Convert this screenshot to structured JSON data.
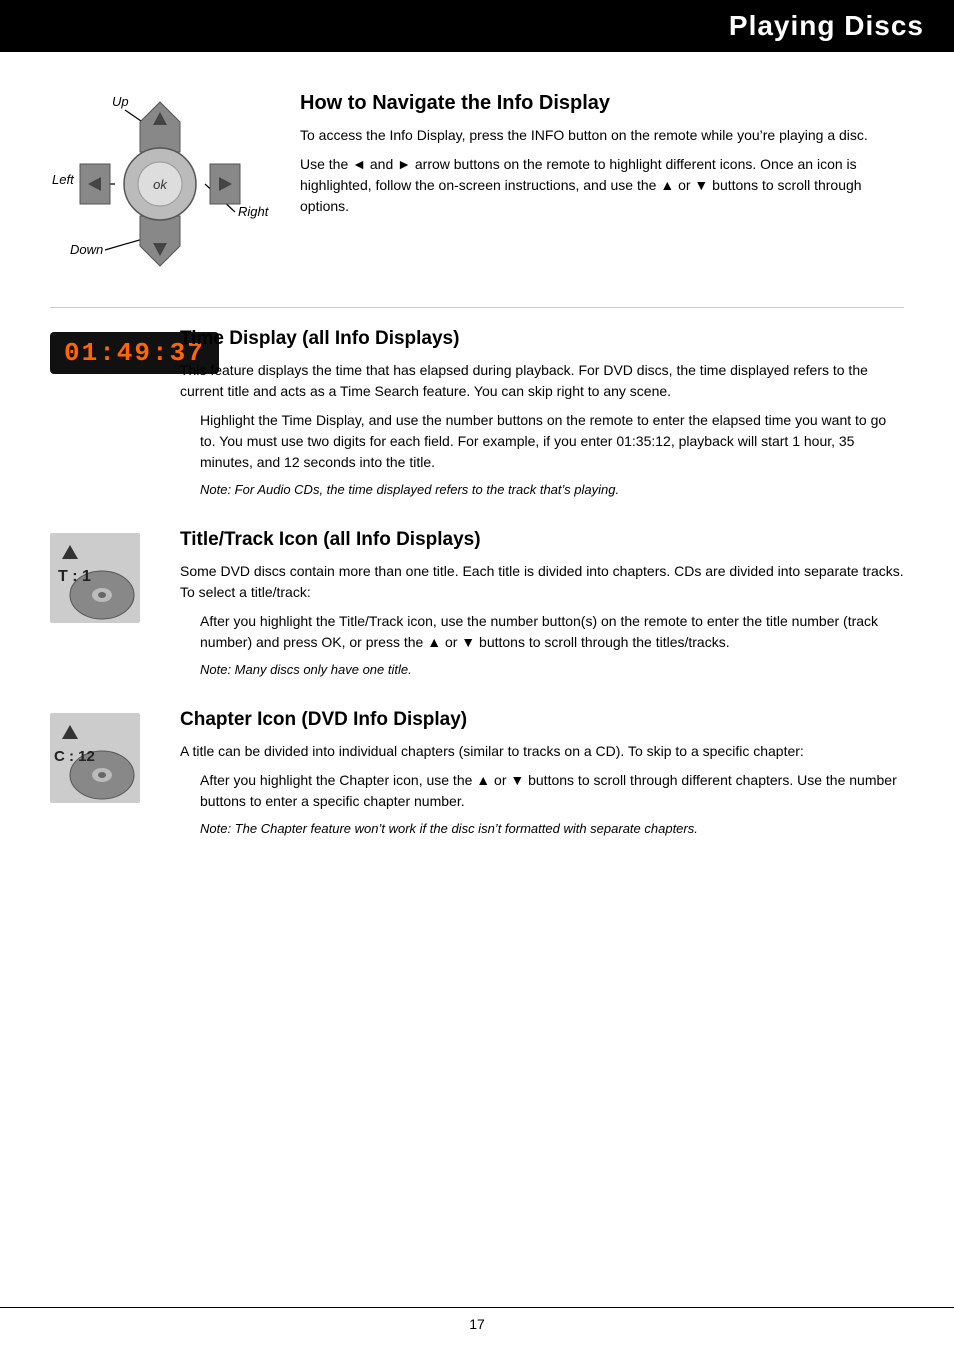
{
  "page": {
    "title": "Playing Discs",
    "page_number": "17"
  },
  "navigate_section": {
    "heading": "How to Navigate the Info Display",
    "para1": "To access the Info Display, press the INFO button on the remote while you’re playing a disc.",
    "para2": "Use the ◄ and ► arrow buttons on the remote to highlight different icons. Once an icon is highlighted, follow the on-screen instructions, and use the ▲ or ▼ buttons to scroll through options.",
    "dpad_labels": {
      "up": "Up",
      "left": "Left",
      "down": "Down",
      "right": "Right",
      "ok": "ok"
    }
  },
  "time_display_section": {
    "badge": "01:49:37",
    "heading": "Time Display (all Info Displays)",
    "para1": "This feature displays the time that has elapsed during playback. For DVD discs, the time displayed refers to the current title and acts as a Time Search feature. You can skip right to any scene.",
    "indented": "Highlight the Time Display, and use the number buttons on the remote to enter the elapsed time you want to go to. You must use two digits for each field. For example, if you enter 01:35:12, playback will start 1 hour, 35 minutes, and 12 seconds into the title.",
    "note": "Note: For Audio CDs, the time displayed refers to the track that’s playing."
  },
  "title_track_section": {
    "heading": "Title/Track Icon (all Info Displays)",
    "icon_label": "T : 1",
    "para1": "Some DVD discs contain more than one title. Each title is divided into chapters. CDs are divided into separate tracks. To select a title/track:",
    "indented": "After you highlight the Title/Track icon, use the number button(s) on the remote to enter the title number (track number) and press OK, or press the ▲ or ▼ buttons to scroll through the titles/tracks.",
    "note": "Note: Many discs only have one title."
  },
  "chapter_section": {
    "heading": "Chapter Icon (DVD Info Display)",
    "icon_label": "C : 12",
    "para1": "A title can be divided into individual chapters (similar to tracks on a CD). To skip to a specific chapter:",
    "indented": "After you highlight the Chapter icon, use the ▲ or ▼ buttons to scroll through different chapters. Use the number buttons to enter a specific chapter number.",
    "note": "Note: The Chapter feature won’t work if the disc isn’t formatted with separate chapters."
  }
}
